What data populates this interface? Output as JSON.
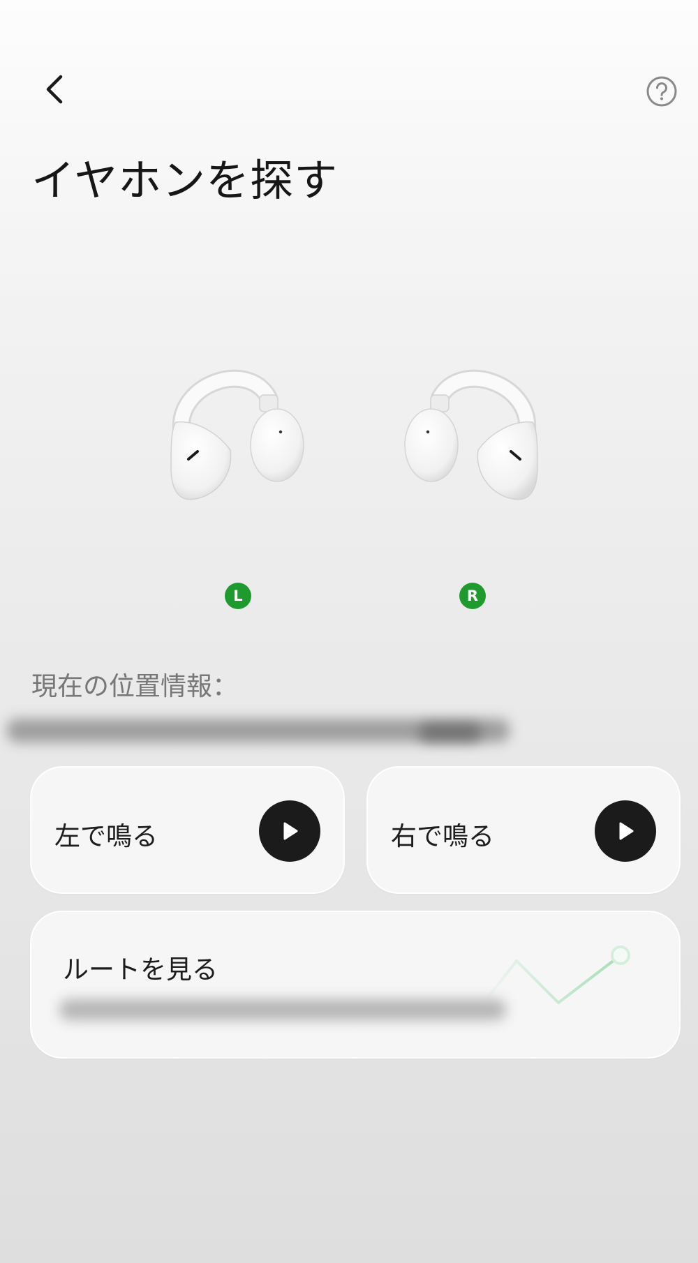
{
  "header": {
    "back_icon": "chevron-left-icon",
    "help_icon": "question-circle-icon",
    "title": "イヤホンを探す"
  },
  "earbuds": {
    "left_badge": "L",
    "right_badge": "R",
    "badge_color": "#1f9a2f"
  },
  "location": {
    "label": "現在の位置情報："
  },
  "actions": {
    "ring_left_label": "左で鳴る",
    "ring_right_label": "右で鳴る",
    "play_icon": "play-icon",
    "route_label": "ルートを見る",
    "route_icon": "route-graph-icon",
    "accent_color": "#9fdcb0"
  }
}
